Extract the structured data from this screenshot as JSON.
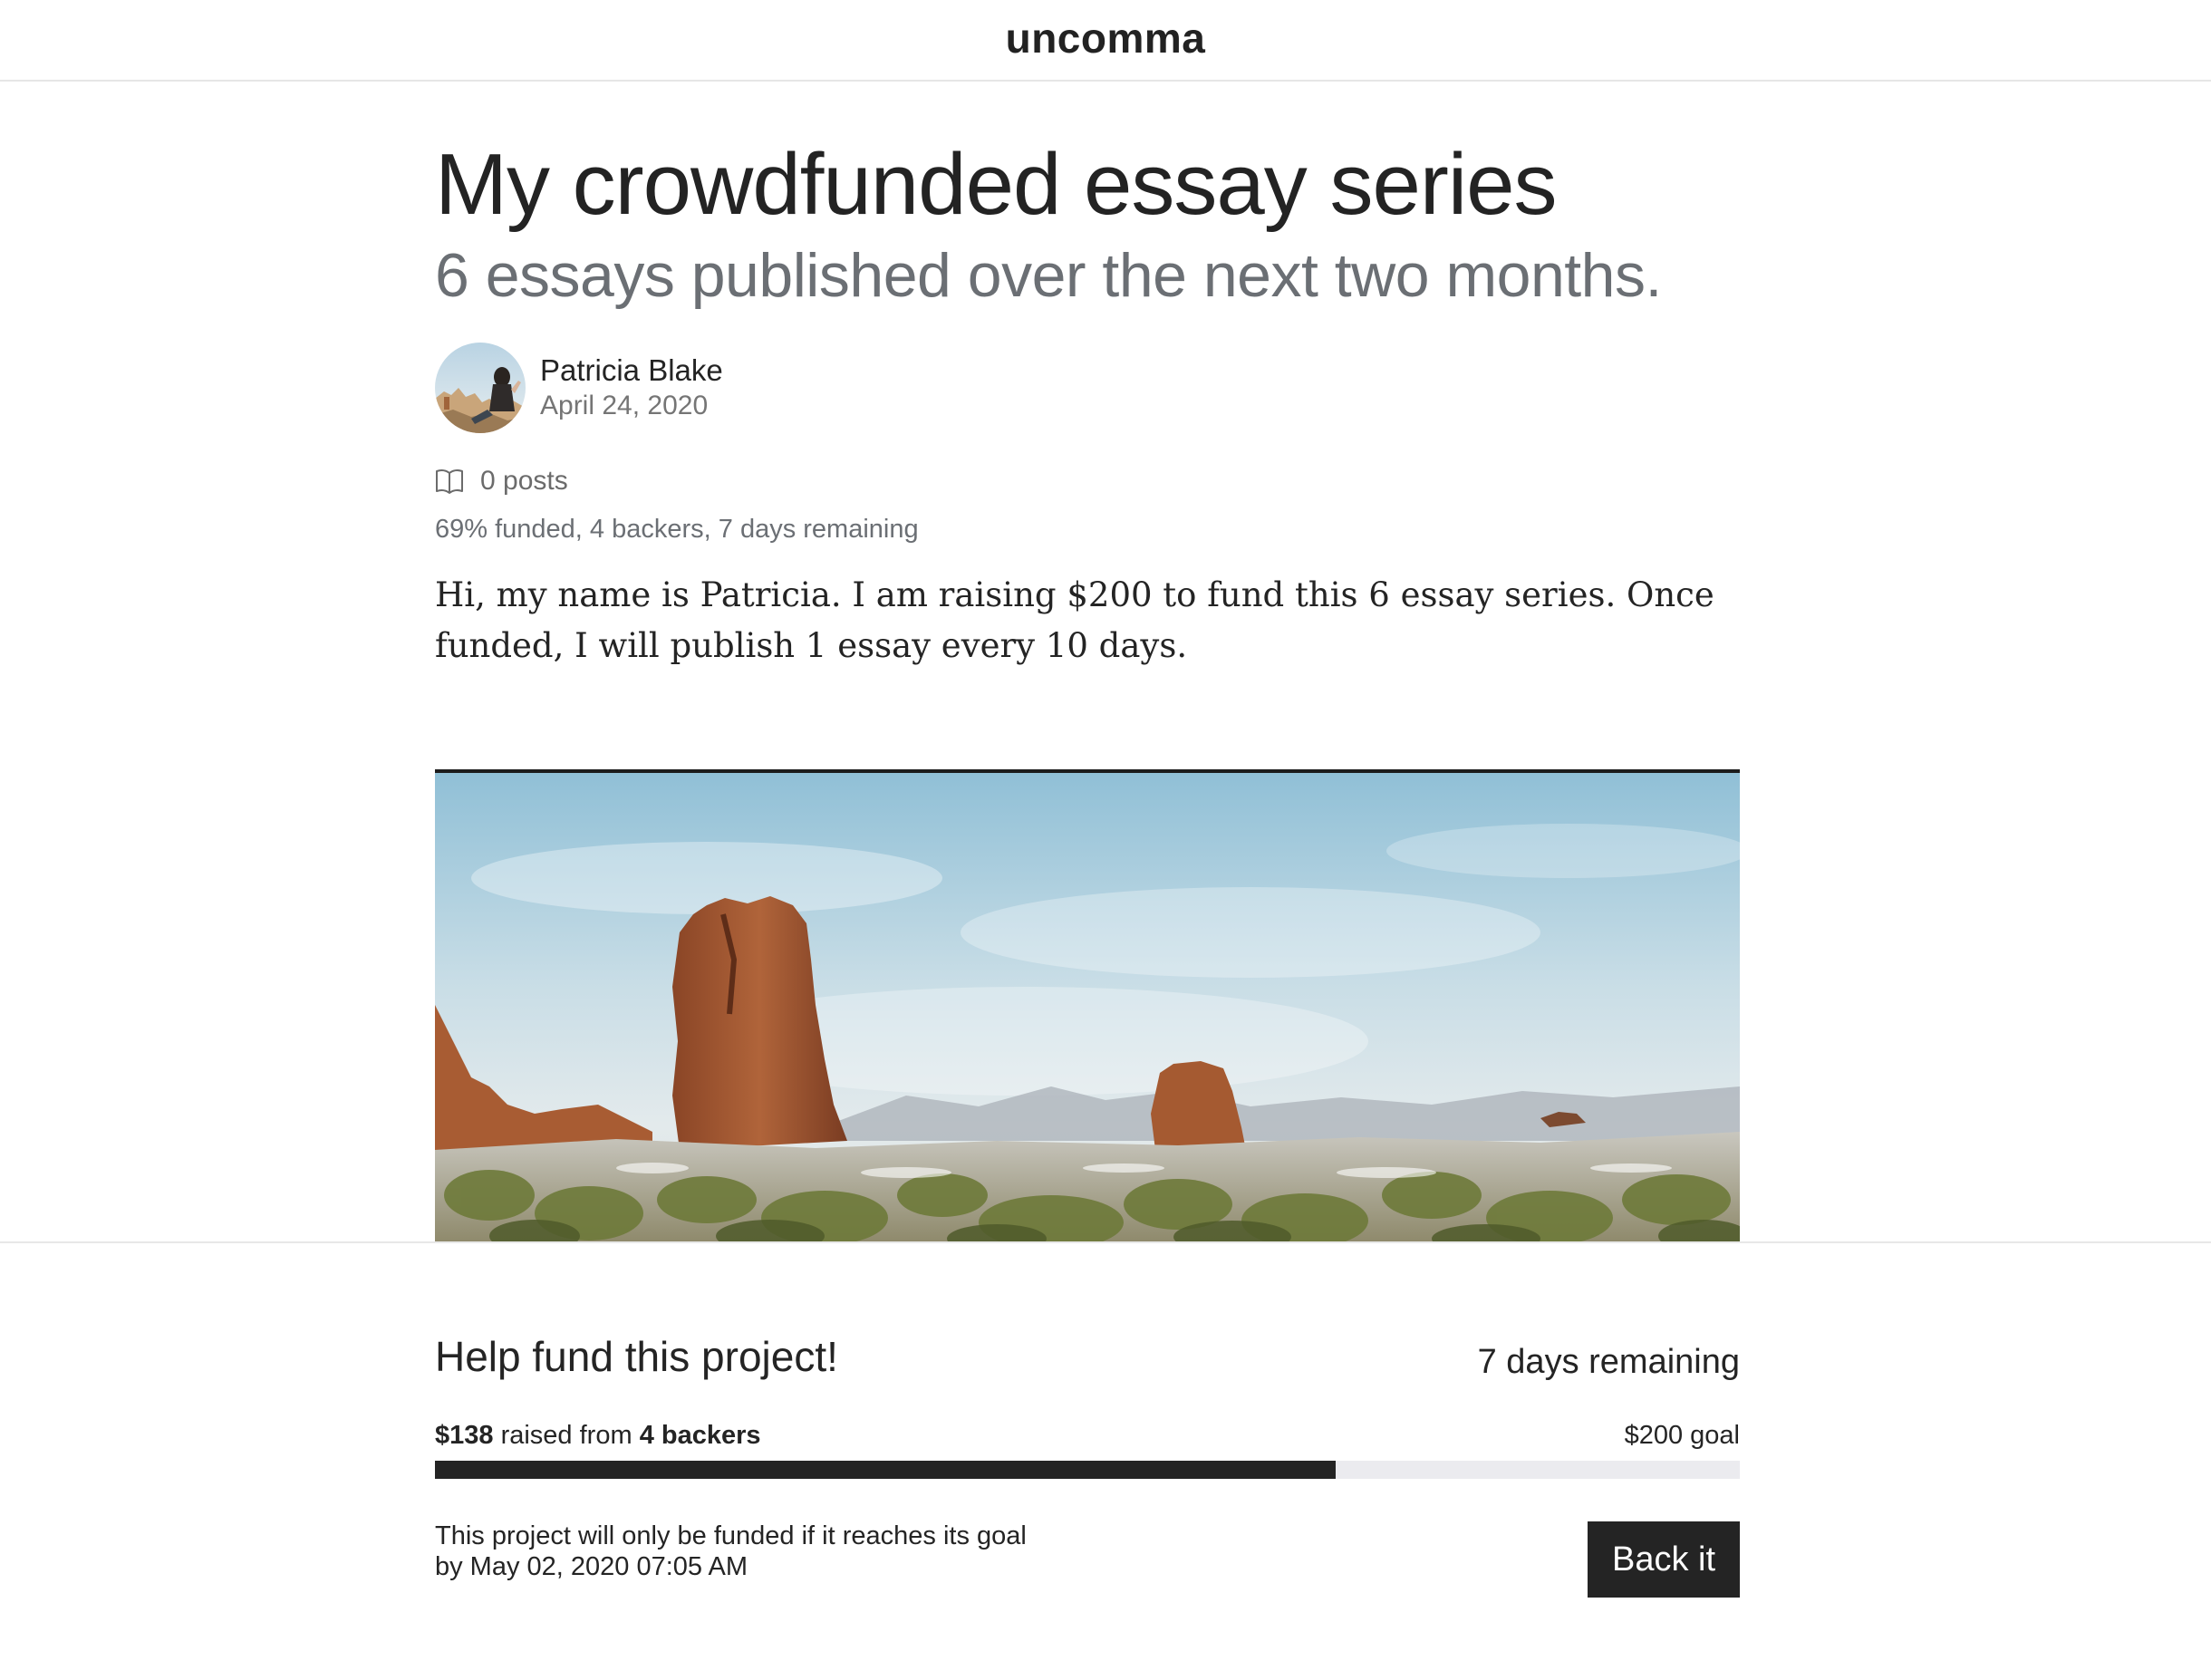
{
  "site": {
    "brand": "uncomma"
  },
  "article": {
    "title": "My crowdfunded essay series",
    "subtitle": "6 essays published over the next two months.",
    "author": {
      "name": "Patricia Blake",
      "date": "April 24, 2020"
    },
    "posts_count_label": "0 posts",
    "funding_summary": "69% funded, 4 backers, 7 days remaining",
    "body_paragraph": "Hi, my name is Patricia. I am raising $200 to fund this 6 essay series. Once funded, I will publish 1 essay every 10 days."
  },
  "funding": {
    "heading": "Help fund this project!",
    "remaining": "7 days remaining",
    "raised_amount": "$138",
    "raised_text": " raised from ",
    "backers": "4 backers",
    "goal": "$200 goal",
    "progress_fraction": 0.69,
    "note_line1": "This project will only be funded if it reaches its goal",
    "note_line2": "by May 02, 2020 07:05 AM",
    "back_button": "Back it"
  },
  "colors": {
    "text": "#242424",
    "muted": "#6b6f74",
    "progress_fill": "#242424",
    "progress_track": "#ebebef"
  },
  "icons": {
    "posts": "book-open-icon"
  }
}
